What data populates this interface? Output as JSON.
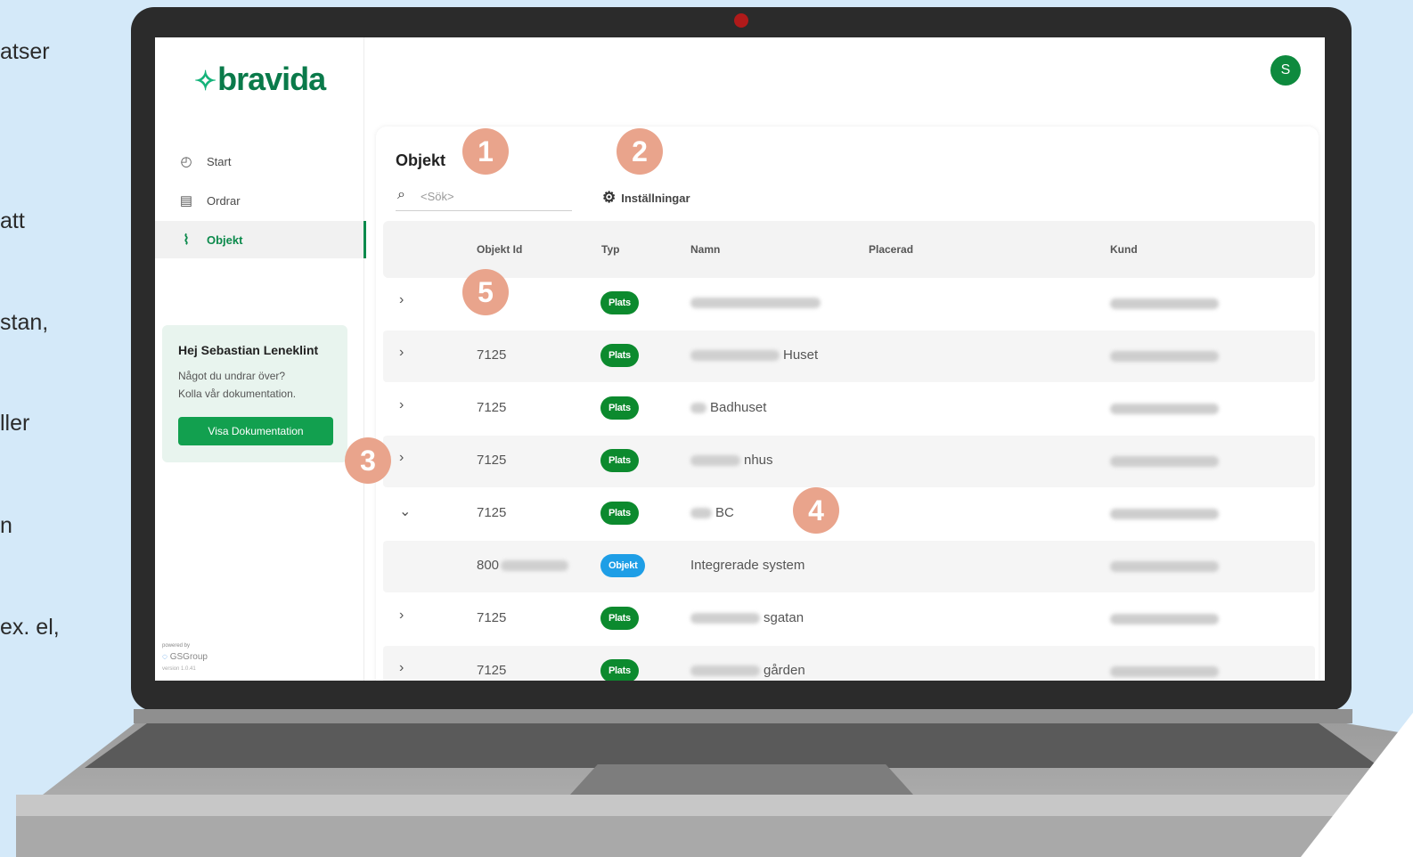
{
  "side_snippets": [
    "atser",
    "att",
    "stan,",
    "ller",
    "n",
    "ex. el,"
  ],
  "brand": {
    "name": "bravida",
    "mark": "✧"
  },
  "nav": [
    {
      "label": "Start",
      "icon": "speedometer-icon"
    },
    {
      "label": "Ordrar",
      "icon": "list-icon"
    },
    {
      "label": "Objekt",
      "icon": "pulse-icon",
      "active": true
    }
  ],
  "help": {
    "title": "Hej Sebastian Leneklint",
    "line1": "Något du undrar över?",
    "line2": "Kolla vår dokumentation.",
    "button": "Visa Dokumentation"
  },
  "footer": {
    "powered": "powered by",
    "brand": "GSGroup",
    "version": "version 1.0.41"
  },
  "user": {
    "initial": "S"
  },
  "main": {
    "title": "Objekt",
    "search_placeholder": "<Sök>",
    "settings_label": "Inställningar"
  },
  "table": {
    "columns": [
      "Objekt Id",
      "Typ",
      "Namn",
      "Placerad",
      "Kund"
    ],
    "rows": [
      {
        "id": "",
        "type": "Plats",
        "name": "",
        "expanded": false
      },
      {
        "id": "7125",
        "type": "Plats",
        "name": "Huset",
        "expanded": false
      },
      {
        "id": "7125",
        "type": "Plats",
        "name": "Badhuset",
        "expanded": false
      },
      {
        "id": "7125",
        "type": "Plats",
        "name": "nhus",
        "expanded": false
      },
      {
        "id": "7125",
        "type": "Plats",
        "name": "BC",
        "expanded": true
      },
      {
        "id": "800",
        "type": "Objekt",
        "name": "Integrerade system",
        "child": true
      },
      {
        "id": "7125",
        "type": "Plats",
        "name": "sgatan",
        "expanded": false
      },
      {
        "id": "7125",
        "type": "Plats",
        "name": "gården",
        "expanded": false
      }
    ]
  },
  "markers": [
    "1",
    "2",
    "3",
    "4",
    "5"
  ],
  "colors": {
    "brand_green": "#0c8a4c",
    "plats_badge": "#0c8a2e",
    "objekt_badge": "#1e9ee6",
    "marker": "#e9a48c"
  }
}
